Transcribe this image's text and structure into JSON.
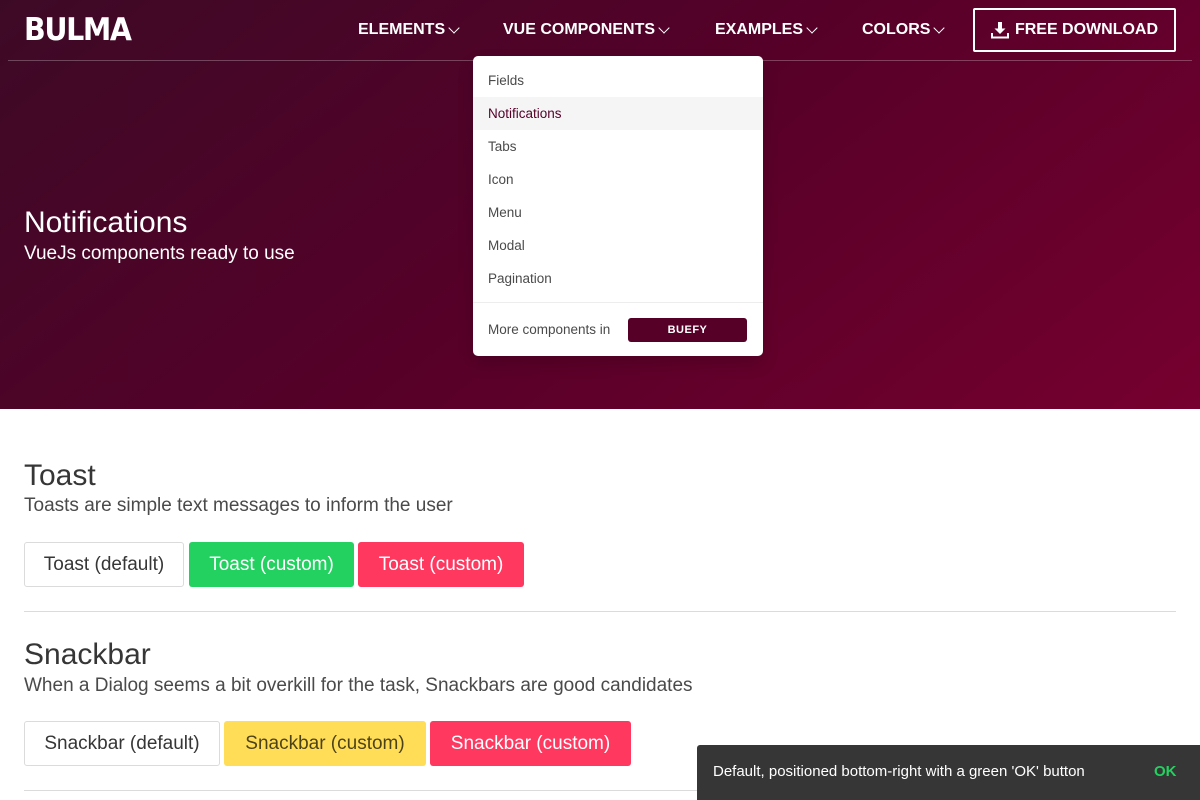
{
  "navbar": {
    "brand": "BULMA",
    "items": [
      {
        "label": "ELEMENTS"
      },
      {
        "label": "VUE COMPONENTS"
      },
      {
        "label": "EXAMPLES"
      },
      {
        "label": "COLORS"
      }
    ],
    "download_label": "FREE DOWNLOAD",
    "icons": {
      "chevron": "chevron-down-icon",
      "download": "download-icon"
    }
  },
  "hero": {
    "title": "Notifications",
    "subtitle": "VueJs components ready to use"
  },
  "dropdown": {
    "items": [
      {
        "label": "Fields",
        "active": false
      },
      {
        "label": "Notifications",
        "active": true
      },
      {
        "label": "Tabs",
        "active": false
      },
      {
        "label": "Icon",
        "active": false
      },
      {
        "label": "Menu",
        "active": false
      },
      {
        "label": "Modal",
        "active": false
      },
      {
        "label": "Pagination",
        "active": false
      }
    ],
    "footer_label": "More components in",
    "footer_button": "BUEFY"
  },
  "toast": {
    "title": "Toast",
    "subtitle": "Toasts are simple text messages to inform the user",
    "buttons": [
      {
        "label": "Toast (default)",
        "style": "default"
      },
      {
        "label": "Toast (custom)",
        "style": "green"
      },
      {
        "label": "Toast (custom)",
        "style": "red"
      }
    ]
  },
  "snackbar_section": {
    "title": "Snackbar",
    "subtitle": "When a Dialog seems a bit overkill for the task, Snackbars are good candidates",
    "buttons": [
      {
        "label": "Snackbar (default)",
        "style": "default"
      },
      {
        "label": "Snackbar (custom)",
        "style": "yellow"
      },
      {
        "label": "Snackbar (custom)",
        "style": "red"
      }
    ]
  },
  "snackbar": {
    "message": "Default, positioned bottom-right with a green 'OK' button",
    "action": "OK"
  },
  "colors": {
    "brand": "#560028",
    "green": "#23d160",
    "red": "#ff3860",
    "yellow": "#ffdd57",
    "snackbar_bg": "#363636"
  }
}
